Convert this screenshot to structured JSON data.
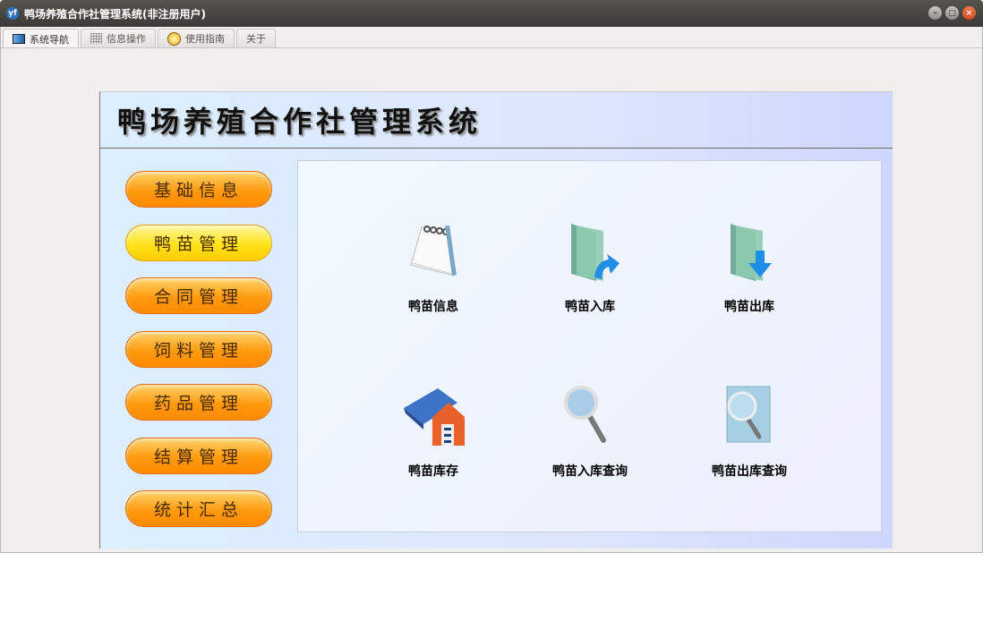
{
  "window": {
    "title": "鸭场养殖合作社管理系统(非注册用户)",
    "app_icon": "yf"
  },
  "tabs": [
    {
      "label": "系统导航",
      "icon": "monitor-icon"
    },
    {
      "label": "信息操作",
      "icon": "grid-icon"
    },
    {
      "label": "使用指南",
      "icon": "help-icon"
    },
    {
      "label": "关于"
    }
  ],
  "header": {
    "title": "鸭场养殖合作社管理系统"
  },
  "nav": [
    "基础信息",
    "鸭苗管理",
    "合同管理",
    "饲料管理",
    "药品管理",
    "结算管理",
    "统计汇总"
  ],
  "actions": [
    {
      "label": "鸭苗信息",
      "icon": "notepad-icon"
    },
    {
      "label": "鸭苗入库",
      "icon": "folder-in-icon"
    },
    {
      "label": "鸭苗出库",
      "icon": "folder-out-icon"
    },
    {
      "label": "鸭苗库存",
      "icon": "warehouse-icon"
    },
    {
      "label": "鸭苗入库查询",
      "icon": "magnifier-icon"
    },
    {
      "label": "鸭苗出库查询",
      "icon": "document-search-icon"
    }
  ]
}
